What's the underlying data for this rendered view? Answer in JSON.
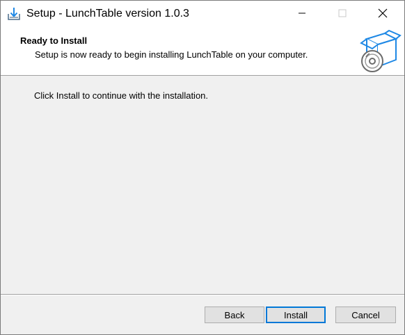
{
  "window": {
    "title": "Setup - LunchTable version 1.0.3",
    "controls": [
      "minimize-icon",
      "maximize-icon",
      "close-icon"
    ]
  },
  "header": {
    "title": "Ready to Install",
    "subtitle": "Setup is now ready to begin installing LunchTable on your computer.",
    "icon": "box-disc-icon"
  },
  "body": {
    "text": "Click Install to continue with the installation."
  },
  "buttons": {
    "back": "Back",
    "install": "Install",
    "cancel": "Cancel"
  },
  "colors": {
    "accent": "#0078d7",
    "header_bg": "#ffffff",
    "body_bg": "#f0f0f0",
    "button_bg": "#e1e1e1"
  }
}
